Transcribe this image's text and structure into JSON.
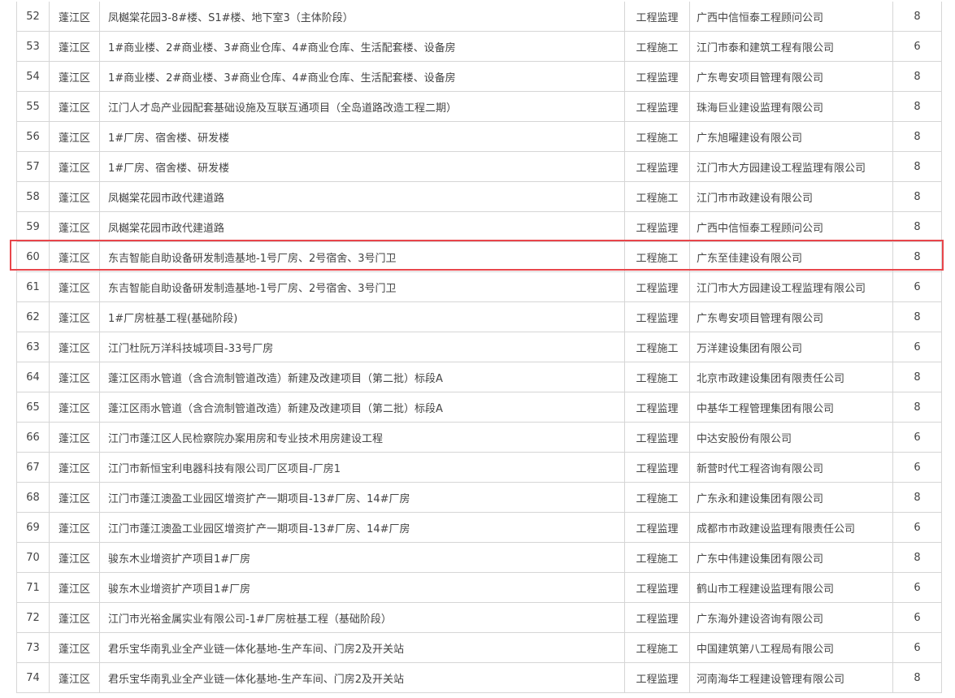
{
  "rows": [
    {
      "no": "52",
      "district": "蓬江区",
      "project": "凤樾棠花园3-8#楼、S1#楼、地下室3（主体阶段）",
      "type": "工程监理",
      "company": "广西中信恒泰工程顾问公司",
      "score": "8"
    },
    {
      "no": "53",
      "district": "蓬江区",
      "project": "1#商业楼、2#商业楼、3#商业仓库、4#商业仓库、生活配套楼、设备房",
      "type": "工程施工",
      "company": "江门市泰和建筑工程有限公司",
      "score": "6"
    },
    {
      "no": "54",
      "district": "蓬江区",
      "project": "1#商业楼、2#商业楼、3#商业仓库、4#商业仓库、生活配套楼、设备房",
      "type": "工程监理",
      "company": "广东粤安项目管理有限公司",
      "score": "8"
    },
    {
      "no": "55",
      "district": "蓬江区",
      "project": "江门人才岛产业园配套基础设施及互联互通项目（全岛道路改造工程二期）",
      "type": "工程监理",
      "company": "珠海巨业建设监理有限公司",
      "score": "8"
    },
    {
      "no": "56",
      "district": "蓬江区",
      "project": "1#厂房、宿舍楼、研发楼",
      "type": "工程施工",
      "company": "广东旭曜建设有限公司",
      "score": "8"
    },
    {
      "no": "57",
      "district": "蓬江区",
      "project": "1#厂房、宿舍楼、研发楼",
      "type": "工程监理",
      "company": "江门市大方园建设工程监理有限公司",
      "score": "8"
    },
    {
      "no": "58",
      "district": "蓬江区",
      "project": "凤樾棠花园市政代建道路",
      "type": "工程施工",
      "company": "江门市市政建设有限公司",
      "score": "8"
    },
    {
      "no": "59",
      "district": "蓬江区",
      "project": "凤樾棠花园市政代建道路",
      "type": "工程监理",
      "company": "广西中信恒泰工程顾问公司",
      "score": "8"
    },
    {
      "no": "60",
      "district": "蓬江区",
      "project": "东吉智能自助设备研发制造基地-1号厂房、2号宿舍、3号门卫",
      "type": "工程施工",
      "company": "广东至佳建设有限公司",
      "score": "8"
    },
    {
      "no": "61",
      "district": "蓬江区",
      "project": "东吉智能自助设备研发制造基地-1号厂房、2号宿舍、3号门卫",
      "type": "工程监理",
      "company": "江门市大方园建设工程监理有限公司",
      "score": "6"
    },
    {
      "no": "62",
      "district": "蓬江区",
      "project": "1#厂房桩基工程(基础阶段)",
      "type": "工程监理",
      "company": "广东粤安项目管理有限公司",
      "score": "8"
    },
    {
      "no": "63",
      "district": "蓬江区",
      "project": "江门杜阮万洋科技城项目-33号厂房",
      "type": "工程施工",
      "company": "万洋建设集团有限公司",
      "score": "6"
    },
    {
      "no": "64",
      "district": "蓬江区",
      "project": "蓬江区雨水管道（含合流制管道改造）新建及改建项目（第二批）标段A",
      "type": "工程施工",
      "company": "北京市政建设集团有限责任公司",
      "score": "8"
    },
    {
      "no": "65",
      "district": "蓬江区",
      "project": "蓬江区雨水管道（含合流制管道改造）新建及改建项目（第二批）标段A",
      "type": "工程监理",
      "company": "中基华工程管理集团有限公司",
      "score": "8"
    },
    {
      "no": "66",
      "district": "蓬江区",
      "project": "江门市蓬江区人民检察院办案用房和专业技术用房建设工程",
      "type": "工程监理",
      "company": "中达安股份有限公司",
      "score": "6"
    },
    {
      "no": "67",
      "district": "蓬江区",
      "project": "江门市新恒宝利电器科技有限公司厂区项目-厂房1",
      "type": "工程监理",
      "company": "新营时代工程咨询有限公司",
      "score": "6"
    },
    {
      "no": "68",
      "district": "蓬江区",
      "project": "江门市蓬江澳盈工业园区增资扩产一期项目-13#厂房、14#厂房",
      "type": "工程施工",
      "company": "广东永和建设集团有限公司",
      "score": "8"
    },
    {
      "no": "69",
      "district": "蓬江区",
      "project": "江门市蓬江澳盈工业园区增资扩产一期项目-13#厂房、14#厂房",
      "type": "工程监理",
      "company": "成都市市政建设监理有限责任公司",
      "score": "6"
    },
    {
      "no": "70",
      "district": "蓬江区",
      "project": "骏东木业增资扩产项目1#厂房",
      "type": "工程施工",
      "company": "广东中伟建设集团有限公司",
      "score": "8"
    },
    {
      "no": "71",
      "district": "蓬江区",
      "project": "骏东木业增资扩产项目1#厂房",
      "type": "工程监理",
      "company": "鹤山市工程建设监理有限公司",
      "score": "6"
    },
    {
      "no": "72",
      "district": "蓬江区",
      "project": "江门市光裕金属实业有限公司-1#厂房桩基工程（基础阶段）",
      "type": "工程监理",
      "company": "广东海外建设咨询有限公司",
      "score": "6"
    },
    {
      "no": "73",
      "district": "蓬江区",
      "project": "君乐宝华南乳业全产业链一体化基地-生产车间、门房2及开关站",
      "type": "工程施工",
      "company": "中国建筑第八工程局有限公司",
      "score": "6"
    },
    {
      "no": "74",
      "district": "蓬江区",
      "project": "君乐宝华南乳业全产业链一体化基地-生产车间、门房2及开关站",
      "type": "工程监理",
      "company": "河南海华工程建设管理有限公司",
      "score": "8"
    }
  ],
  "highlight_color": "#e8464b",
  "border_color": "#d6d6d6",
  "text_color": "#444444"
}
